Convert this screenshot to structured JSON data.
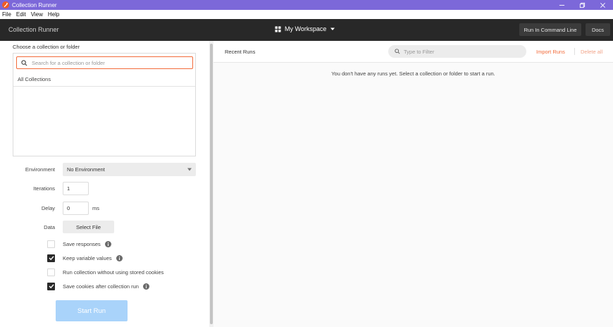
{
  "window": {
    "title": "Collection Runner"
  },
  "menu": [
    "File",
    "Edit",
    "View",
    "Help"
  ],
  "header": {
    "title": "Collection Runner",
    "workspace": "My Workspace",
    "run_cli_label": "Run In Command Line",
    "docs_label": "Docs"
  },
  "left": {
    "choose_label": "Choose a collection or folder",
    "search_placeholder": "Search for a collection or folder",
    "all_collections": "All Collections",
    "environment_label": "Environment",
    "environment_value": "No Environment",
    "iterations_label": "Iterations",
    "iterations_value": "1",
    "delay_label": "Delay",
    "delay_value": "0",
    "delay_unit": "ms",
    "data_label": "Data",
    "select_file_label": "Select File",
    "options": [
      {
        "label": "Save responses",
        "checked": false,
        "info": true
      },
      {
        "label": "Keep variable values",
        "checked": true,
        "info": true
      },
      {
        "label": "Run collection without using stored cookies",
        "checked": false,
        "info": false
      },
      {
        "label": "Save cookies after collection run",
        "checked": true,
        "info": true
      }
    ],
    "start_run_label": "Start Run"
  },
  "right": {
    "recent_runs_title": "Recent Runs",
    "filter_placeholder": "Type to Filter",
    "import_runs_label": "Import Runs",
    "delete_all_label": "Delete all",
    "empty_message": "You don't have any runs yet. Select a collection or folder to start a run."
  },
  "colors": {
    "titlebar": "#7c68d9",
    "header": "#282828",
    "accent": "#f26b3a",
    "start_run": "#a9d3fa"
  }
}
